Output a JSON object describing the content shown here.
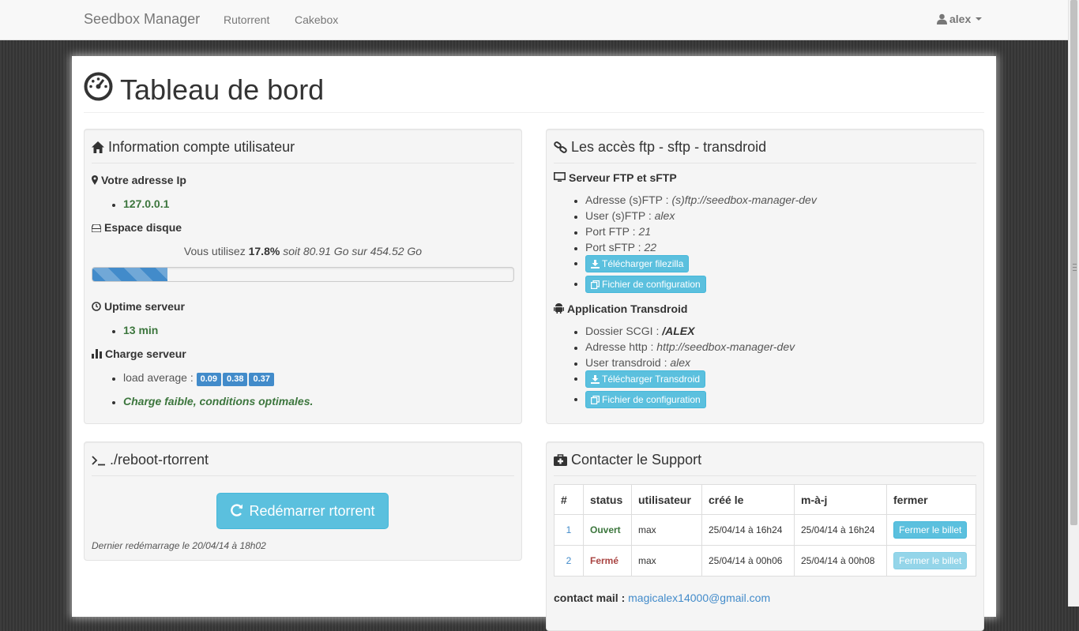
{
  "navbar": {
    "brand": "Seedbox Manager",
    "links": [
      "Rutorrent",
      "Cakebox"
    ],
    "user": "alex"
  },
  "page": {
    "title": "Tableau de bord"
  },
  "account_panel": {
    "title": "Information compte utilisateur",
    "ip_heading": "Votre adresse Ip",
    "ip_value": "127.0.0.1",
    "disk_heading": "Espace disque",
    "disk_prefix": "Vous utilisez",
    "disk_percent": "17.8%",
    "disk_detail": "soit 80.91 Go sur 454.52 Go",
    "disk_fill_percent": 17.8,
    "uptime_heading": "Uptime serveur",
    "uptime_value": "13 min",
    "load_heading": "Charge serveur",
    "load_label": "load average :",
    "load_values": [
      "0.09",
      "0.38",
      "0.37"
    ],
    "load_status": "Charge faible, conditions optimales."
  },
  "ftp_panel": {
    "title": "Les accès ftp - sftp - transdroid",
    "ftp_heading": "Serveur FTP et sFTP",
    "ftp_items": [
      {
        "label": "Adresse (s)FTP :",
        "value": "(s)ftp://seedbox-manager-dev"
      },
      {
        "label": "User (s)FTP :",
        "value": "alex"
      },
      {
        "label": "Port FTP :",
        "value": "21"
      },
      {
        "label": "Port sFTP :",
        "value": "22"
      }
    ],
    "btn_filezilla": "Télécharger filezilla",
    "btn_config": "Fichier de configuration",
    "transdroid_heading": "Application Transdroid",
    "transdroid_items": [
      {
        "label": "Dossier SCGI :",
        "value": "/ALEX"
      },
      {
        "label": "Adresse http :",
        "value": "http://seedbox-manager-dev"
      },
      {
        "label": "User transdroid :",
        "value": "alex"
      }
    ],
    "btn_transdroid": "Télécharger Transdroid",
    "btn_config2": "Fichier de configuration"
  },
  "reboot_panel": {
    "title": "./reboot-rtorrent",
    "button": "Redémarrer rtorrent",
    "note": "Dernier redémarrage le 20/04/14 à 18h02"
  },
  "support_panel": {
    "title": "Contacter le Support",
    "headers": [
      "#",
      "status",
      "utilisateur",
      "créé le",
      "m-à-j",
      "fermer"
    ],
    "rows": [
      {
        "id": "1",
        "status": "Ouvert",
        "user": "max",
        "created": "25/04/14 à 16h24",
        "updated": "25/04/14 à 16h24",
        "action": "Fermer le billet"
      },
      {
        "id": "2",
        "status": "Fermé",
        "user": "max",
        "created": "25/04/14 à 00h06",
        "updated": "25/04/14 à 00h08",
        "action": "Fermer le billet"
      }
    ],
    "contact_label": "contact mail :",
    "contact_email": "magicalex14000@gmail.com"
  },
  "colors": {
    "accent": "#428bca",
    "info": "#5bc0de",
    "success": "#3c763d",
    "danger": "#a94442"
  }
}
